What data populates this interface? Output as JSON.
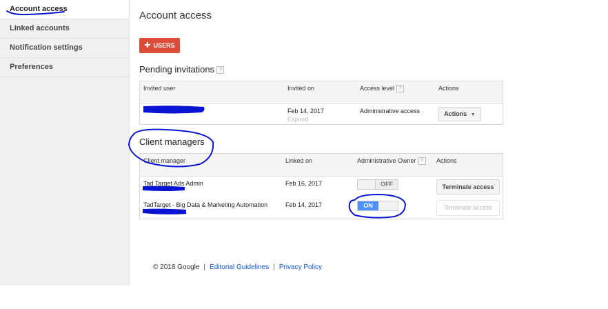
{
  "sidebar": {
    "items": [
      {
        "label": "Account access",
        "active": true
      },
      {
        "label": "Linked accounts",
        "active": false
      },
      {
        "label": "Notification settings",
        "active": false
      },
      {
        "label": "Preferences",
        "active": false
      }
    ]
  },
  "main": {
    "title": "Account access",
    "add_button": {
      "icon": "plus-icon",
      "label": "USERS"
    }
  },
  "pending": {
    "title": "Pending invitations",
    "help": "?",
    "columns": {
      "user": "Invited user",
      "invited_on": "Invited on",
      "access_level": "Access level",
      "actions": "Actions"
    },
    "rows": [
      {
        "user": "",
        "invited_on": "Feb 14, 2017",
        "status": "Expired",
        "access_level": "Administrative access",
        "actions_label": "Actions"
      }
    ]
  },
  "client_managers": {
    "title": "Client managers",
    "help": "?",
    "columns": {
      "manager": "Client manager",
      "linked_on": "Linked on",
      "admin_owner": "Administrative Owner",
      "actions": "Actions"
    },
    "rows": [
      {
        "manager": "Tad Target Ads Admin",
        "linked_on": "Feb 16, 2017",
        "toggle_label": "OFF",
        "toggle_on": false,
        "action_label": "Terminate access",
        "action_enabled": true
      },
      {
        "manager": "TadTarget - Big Data & Marketing Automation",
        "linked_on": "Feb 14, 2017",
        "toggle_label": "ON",
        "toggle_on": true,
        "action_label": "Terminate access",
        "action_enabled": false
      }
    ]
  },
  "footer": {
    "copyright": "© 2018 Google",
    "sep": "|",
    "links": [
      "Editorial Guidelines",
      "Privacy Policy"
    ]
  },
  "colors": {
    "accent_red": "#dd4b39",
    "toggle_blue": "#4d90fe",
    "ink_blue": "#0a14d4",
    "link": "#1155cc"
  }
}
